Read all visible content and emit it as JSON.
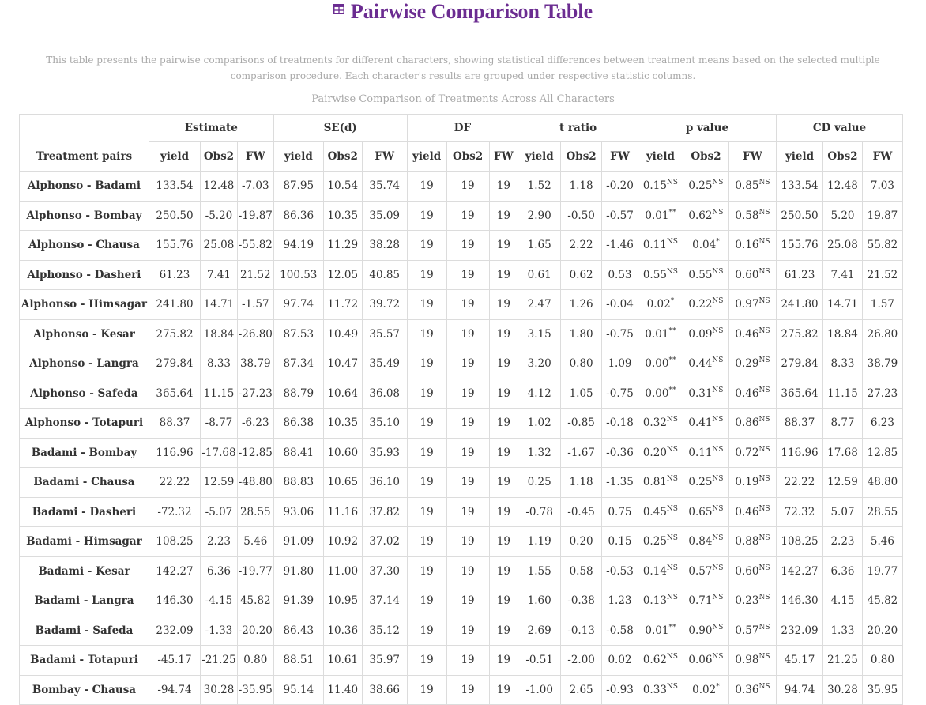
{
  "page": {
    "title": "Pairwise Comparison Table",
    "description": "This table presents the pairwise comparisons of treatments for different characters, showing statistical differences between treatment means based on the selected multiple comparison procedure. Each character's results are grouped under respective statistic columns.",
    "caption": "Pairwise Comparison of Treatments Across All Characters",
    "title_icon": "table-icon",
    "accent_color": "#6b2c91"
  },
  "table": {
    "pair_header": "Treatment pairs",
    "groups": [
      "Estimate",
      "SE(d)",
      "DF",
      "t ratio",
      "p value",
      "CD value"
    ],
    "subcols": [
      "yield",
      "Obs2",
      "FW"
    ],
    "rows": [
      {
        "pair": "Alphonso - Badami",
        "est": [
          "133.54",
          "12.48",
          "-7.03"
        ],
        "se": [
          "87.95",
          "10.54",
          "35.74"
        ],
        "df": [
          "19",
          "19",
          "19"
        ],
        "t": [
          "1.52",
          "1.18",
          "-0.20"
        ],
        "p": [
          [
            "0.15",
            "NS"
          ],
          [
            "0.25",
            "NS"
          ],
          [
            "0.85",
            "NS"
          ]
        ],
        "cd": [
          "133.54",
          "12.48",
          "7.03"
        ]
      },
      {
        "pair": "Alphonso - Bombay",
        "est": [
          "250.50",
          "-5.20",
          "-19.87"
        ],
        "se": [
          "86.36",
          "10.35",
          "35.09"
        ],
        "df": [
          "19",
          "19",
          "19"
        ],
        "t": [
          "2.90",
          "-0.50",
          "-0.57"
        ],
        "p": [
          [
            "0.01",
            "**"
          ],
          [
            "0.62",
            "NS"
          ],
          [
            "0.58",
            "NS"
          ]
        ],
        "cd": [
          "250.50",
          "5.20",
          "19.87"
        ]
      },
      {
        "pair": "Alphonso - Chausa",
        "est": [
          "155.76",
          "25.08",
          "-55.82"
        ],
        "se": [
          "94.19",
          "11.29",
          "38.28"
        ],
        "df": [
          "19",
          "19",
          "19"
        ],
        "t": [
          "1.65",
          "2.22",
          "-1.46"
        ],
        "p": [
          [
            "0.11",
            "NS"
          ],
          [
            "0.04",
            "*"
          ],
          [
            "0.16",
            "NS"
          ]
        ],
        "cd": [
          "155.76",
          "25.08",
          "55.82"
        ]
      },
      {
        "pair": "Alphonso - Dasheri",
        "est": [
          "61.23",
          "7.41",
          "21.52"
        ],
        "se": [
          "100.53",
          "12.05",
          "40.85"
        ],
        "df": [
          "19",
          "19",
          "19"
        ],
        "t": [
          "0.61",
          "0.62",
          "0.53"
        ],
        "p": [
          [
            "0.55",
            "NS"
          ],
          [
            "0.55",
            "NS"
          ],
          [
            "0.60",
            "NS"
          ]
        ],
        "cd": [
          "61.23",
          "7.41",
          "21.52"
        ]
      },
      {
        "pair": "Alphonso - Himsagar",
        "est": [
          "241.80",
          "14.71",
          "-1.57"
        ],
        "se": [
          "97.74",
          "11.72",
          "39.72"
        ],
        "df": [
          "19",
          "19",
          "19"
        ],
        "t": [
          "2.47",
          "1.26",
          "-0.04"
        ],
        "p": [
          [
            "0.02",
            "*"
          ],
          [
            "0.22",
            "NS"
          ],
          [
            "0.97",
            "NS"
          ]
        ],
        "cd": [
          "241.80",
          "14.71",
          "1.57"
        ]
      },
      {
        "pair": "Alphonso - Kesar",
        "est": [
          "275.82",
          "18.84",
          "-26.80"
        ],
        "se": [
          "87.53",
          "10.49",
          "35.57"
        ],
        "df": [
          "19",
          "19",
          "19"
        ],
        "t": [
          "3.15",
          "1.80",
          "-0.75"
        ],
        "p": [
          [
            "0.01",
            "**"
          ],
          [
            "0.09",
            "NS"
          ],
          [
            "0.46",
            "NS"
          ]
        ],
        "cd": [
          "275.82",
          "18.84",
          "26.80"
        ]
      },
      {
        "pair": "Alphonso - Langra",
        "est": [
          "279.84",
          "8.33",
          "38.79"
        ],
        "se": [
          "87.34",
          "10.47",
          "35.49"
        ],
        "df": [
          "19",
          "19",
          "19"
        ],
        "t": [
          "3.20",
          "0.80",
          "1.09"
        ],
        "p": [
          [
            "0.00",
            "**"
          ],
          [
            "0.44",
            "NS"
          ],
          [
            "0.29",
            "NS"
          ]
        ],
        "cd": [
          "279.84",
          "8.33",
          "38.79"
        ]
      },
      {
        "pair": "Alphonso - Safeda",
        "est": [
          "365.64",
          "11.15",
          "-27.23"
        ],
        "se": [
          "88.79",
          "10.64",
          "36.08"
        ],
        "df": [
          "19",
          "19",
          "19"
        ],
        "t": [
          "4.12",
          "1.05",
          "-0.75"
        ],
        "p": [
          [
            "0.00",
            "**"
          ],
          [
            "0.31",
            "NS"
          ],
          [
            "0.46",
            "NS"
          ]
        ],
        "cd": [
          "365.64",
          "11.15",
          "27.23"
        ]
      },
      {
        "pair": "Alphonso - Totapuri",
        "est": [
          "88.37",
          "-8.77",
          "-6.23"
        ],
        "se": [
          "86.38",
          "10.35",
          "35.10"
        ],
        "df": [
          "19",
          "19",
          "19"
        ],
        "t": [
          "1.02",
          "-0.85",
          "-0.18"
        ],
        "p": [
          [
            "0.32",
            "NS"
          ],
          [
            "0.41",
            "NS"
          ],
          [
            "0.86",
            "NS"
          ]
        ],
        "cd": [
          "88.37",
          "8.77",
          "6.23"
        ]
      },
      {
        "pair": "Badami - Bombay",
        "est": [
          "116.96",
          "-17.68",
          "-12.85"
        ],
        "se": [
          "88.41",
          "10.60",
          "35.93"
        ],
        "df": [
          "19",
          "19",
          "19"
        ],
        "t": [
          "1.32",
          "-1.67",
          "-0.36"
        ],
        "p": [
          [
            "0.20",
            "NS"
          ],
          [
            "0.11",
            "NS"
          ],
          [
            "0.72",
            "NS"
          ]
        ],
        "cd": [
          "116.96",
          "17.68",
          "12.85"
        ]
      },
      {
        "pair": "Badami - Chausa",
        "est": [
          "22.22",
          "12.59",
          "-48.80"
        ],
        "se": [
          "88.83",
          "10.65",
          "36.10"
        ],
        "df": [
          "19",
          "19",
          "19"
        ],
        "t": [
          "0.25",
          "1.18",
          "-1.35"
        ],
        "p": [
          [
            "0.81",
            "NS"
          ],
          [
            "0.25",
            "NS"
          ],
          [
            "0.19",
            "NS"
          ]
        ],
        "cd": [
          "22.22",
          "12.59",
          "48.80"
        ]
      },
      {
        "pair": "Badami - Dasheri",
        "est": [
          "-72.32",
          "-5.07",
          "28.55"
        ],
        "se": [
          "93.06",
          "11.16",
          "37.82"
        ],
        "df": [
          "19",
          "19",
          "19"
        ],
        "t": [
          "-0.78",
          "-0.45",
          "0.75"
        ],
        "p": [
          [
            "0.45",
            "NS"
          ],
          [
            "0.65",
            "NS"
          ],
          [
            "0.46",
            "NS"
          ]
        ],
        "cd": [
          "72.32",
          "5.07",
          "28.55"
        ]
      },
      {
        "pair": "Badami - Himsagar",
        "est": [
          "108.25",
          "2.23",
          "5.46"
        ],
        "se": [
          "91.09",
          "10.92",
          "37.02"
        ],
        "df": [
          "19",
          "19",
          "19"
        ],
        "t": [
          "1.19",
          "0.20",
          "0.15"
        ],
        "p": [
          [
            "0.25",
            "NS"
          ],
          [
            "0.84",
            "NS"
          ],
          [
            "0.88",
            "NS"
          ]
        ],
        "cd": [
          "108.25",
          "2.23",
          "5.46"
        ]
      },
      {
        "pair": "Badami - Kesar",
        "est": [
          "142.27",
          "6.36",
          "-19.77"
        ],
        "se": [
          "91.80",
          "11.00",
          "37.30"
        ],
        "df": [
          "19",
          "19",
          "19"
        ],
        "t": [
          "1.55",
          "0.58",
          "-0.53"
        ],
        "p": [
          [
            "0.14",
            "NS"
          ],
          [
            "0.57",
            "NS"
          ],
          [
            "0.60",
            "NS"
          ]
        ],
        "cd": [
          "142.27",
          "6.36",
          "19.77"
        ]
      },
      {
        "pair": "Badami - Langra",
        "est": [
          "146.30",
          "-4.15",
          "45.82"
        ],
        "se": [
          "91.39",
          "10.95",
          "37.14"
        ],
        "df": [
          "19",
          "19",
          "19"
        ],
        "t": [
          "1.60",
          "-0.38",
          "1.23"
        ],
        "p": [
          [
            "0.13",
            "NS"
          ],
          [
            "0.71",
            "NS"
          ],
          [
            "0.23",
            "NS"
          ]
        ],
        "cd": [
          "146.30",
          "4.15",
          "45.82"
        ]
      },
      {
        "pair": "Badami - Safeda",
        "est": [
          "232.09",
          "-1.33",
          "-20.20"
        ],
        "se": [
          "86.43",
          "10.36",
          "35.12"
        ],
        "df": [
          "19",
          "19",
          "19"
        ],
        "t": [
          "2.69",
          "-0.13",
          "-0.58"
        ],
        "p": [
          [
            "0.01",
            "**"
          ],
          [
            "0.90",
            "NS"
          ],
          [
            "0.57",
            "NS"
          ]
        ],
        "cd": [
          "232.09",
          "1.33",
          "20.20"
        ]
      },
      {
        "pair": "Badami - Totapuri",
        "est": [
          "-45.17",
          "-21.25",
          "0.80"
        ],
        "se": [
          "88.51",
          "10.61",
          "35.97"
        ],
        "df": [
          "19",
          "19",
          "19"
        ],
        "t": [
          "-0.51",
          "-2.00",
          "0.02"
        ],
        "p": [
          [
            "0.62",
            "NS"
          ],
          [
            "0.06",
            "NS"
          ],
          [
            "0.98",
            "NS"
          ]
        ],
        "cd": [
          "45.17",
          "21.25",
          "0.80"
        ]
      },
      {
        "pair": "Bombay - Chausa",
        "est": [
          "-94.74",
          "30.28",
          "-35.95"
        ],
        "se": [
          "95.14",
          "11.40",
          "38.66"
        ],
        "df": [
          "19",
          "19",
          "19"
        ],
        "t": [
          "-1.00",
          "2.65",
          "-0.93"
        ],
        "p": [
          [
            "0.33",
            "NS"
          ],
          [
            "0.02",
            "*"
          ],
          [
            "0.36",
            "NS"
          ]
        ],
        "cd": [
          "94.74",
          "30.28",
          "35.95"
        ]
      }
    ]
  }
}
